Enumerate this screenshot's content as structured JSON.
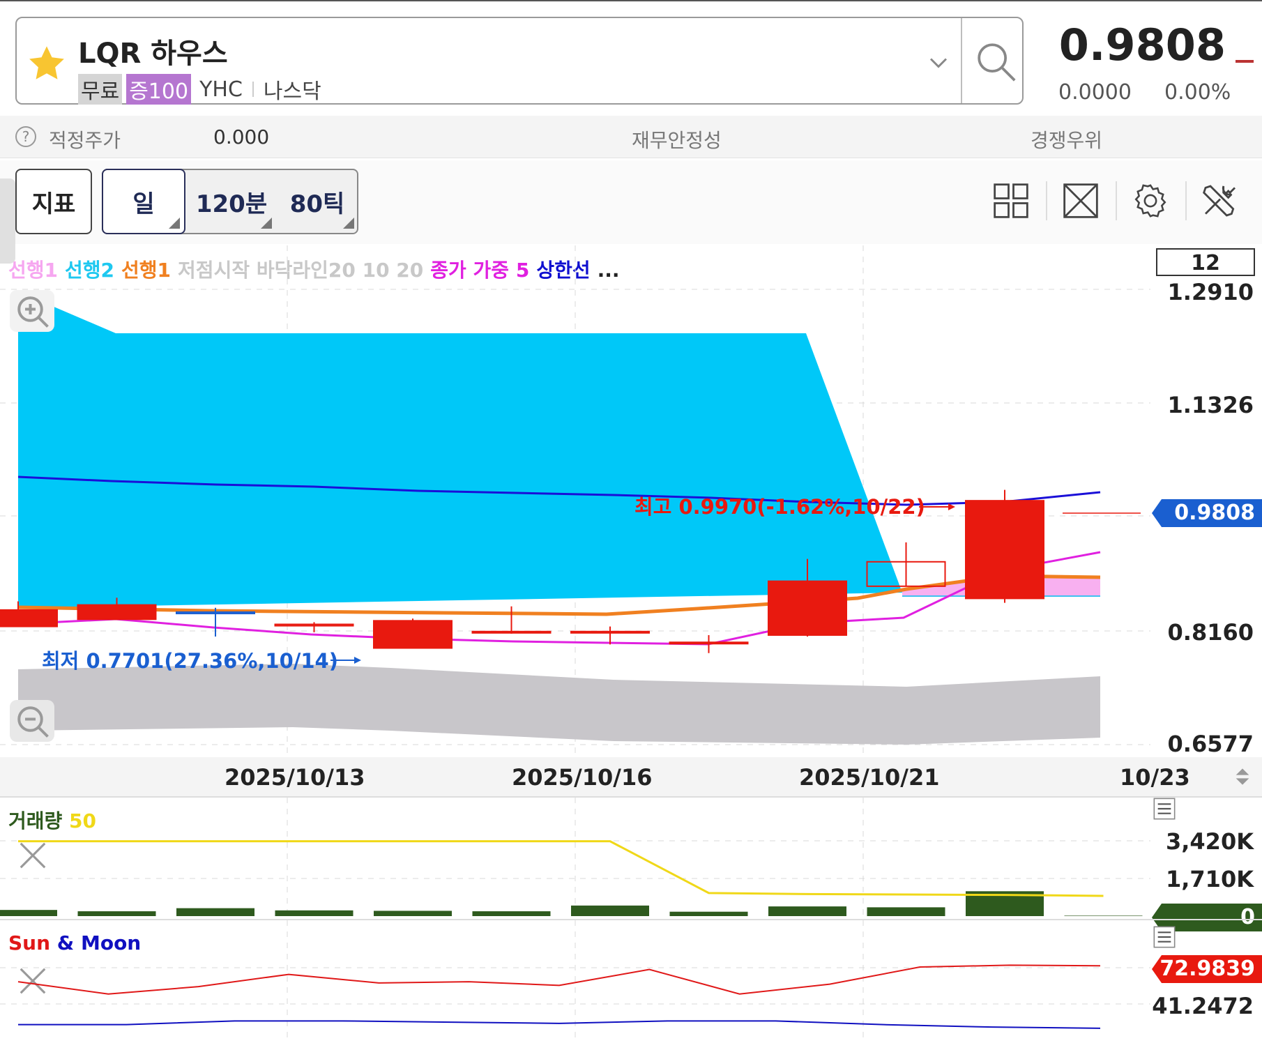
{
  "ticker": {
    "name": "LQR 하우스",
    "badge_free": "무료",
    "badge_margin": "증100",
    "symbol": "YHC",
    "market": "나스닥",
    "price": "0.9808",
    "change": "0.0000",
    "change_pct": "0.00%"
  },
  "valuation": {
    "fair_price_label": "적정주가",
    "fair_price_value": "0.000",
    "financial_label": "재무안정성",
    "competitive_label": "경쟁우위"
  },
  "toolbar": {
    "indicator_label": "지표",
    "period_day": "일",
    "period_min": "120분",
    "period_tick": "80틱"
  },
  "legend": {
    "items": [
      {
        "label": "선행1",
        "color": "#f6a6f0"
      },
      {
        "label": "선행2",
        "color": "#1ec8f0"
      },
      {
        "label": "선행1",
        "color": "#f08020"
      },
      {
        "label": "저점시작 바닥라인20 10 20",
        "color": "#c8c8c8"
      },
      {
        "label": "종가 가중 5",
        "color": "#e020e0"
      },
      {
        "label": "상한선",
        "color": "#1010d0"
      },
      {
        "label": "...",
        "color": "#222222"
      }
    ],
    "count": "12"
  },
  "colors": {
    "up": "#e8190f",
    "cloud_blue": "#00c8f8",
    "cloud_pink": "#f8b0f0",
    "floor_band": "#c8c6ca",
    "upper_line": "#1a0fd8",
    "wma_line": "#e020e0",
    "span1_line": "#f08020",
    "volume_bar": "#2e5a1e",
    "volume_ma": "#f0d818",
    "sun_line": "#e01818",
    "moon_line": "#1010c0",
    "price_tag": "#1a5fd0"
  },
  "chart_data": [
    {
      "type": "candlestick",
      "y_ticks": [
        "1.2910",
        "1.1326",
        "0.9808",
        "0.8160",
        "0.6577"
      ],
      "ylim": [
        0.6577,
        1.291
      ],
      "x_ticks": [
        "2025/10/13",
        "2025/10/16",
        "2025/10/21",
        "10/23"
      ],
      "candles": [
        {
          "open": 0.845,
          "close": 0.822,
          "high": 0.857,
          "low": 0.822
        },
        {
          "open": 0.852,
          "close": 0.832,
          "high": 0.862,
          "low": 0.832
        },
        {
          "open": 0.842,
          "close": 0.84,
          "high": 0.848,
          "low": 0.808
        },
        {
          "open": 0.823,
          "close": 0.825,
          "high": 0.828,
          "low": 0.814
        },
        {
          "open": 0.83,
          "close": 0.792,
          "high": 0.833,
          "low": 0.792
        },
        {
          "open": 0.815,
          "close": 0.815,
          "high": 0.85,
          "low": 0.812
        },
        {
          "open": 0.815,
          "close": 0.815,
          "high": 0.822,
          "low": 0.797
        },
        {
          "open": 0.8,
          "close": 0.8,
          "high": 0.81,
          "low": 0.785
        },
        {
          "open": 0.81,
          "close": 0.885,
          "high": 0.916,
          "low": 0.808
        },
        {
          "open": 0.878,
          "close": 0.912,
          "high": 0.939,
          "low": 0.878
        },
        {
          "open": 0.861,
          "close": 0.997,
          "high": 1.012,
          "low": 0.855
        }
      ],
      "high_annotation": "최고 0.9970(-1.62%,10/22)",
      "low_annotation": "최저 0.7701(27.36%,10/14)",
      "last_price": "0.9808"
    },
    {
      "type": "bar",
      "title": "거래량",
      "ma_label": "50",
      "y_ticks": [
        "3,420K",
        "1,710K",
        "0"
      ],
      "ylim": [
        0,
        3420
      ],
      "values": [
        280,
        220,
        360,
        260,
        240,
        220,
        480,
        200,
        440,
        400,
        1130,
        20
      ],
      "ma_values": [
        3400,
        3400,
        3400,
        3400,
        3400,
        3400,
        3400,
        1050,
        1000,
        980,
        960,
        920
      ]
    },
    {
      "type": "line",
      "title_sun": "Sun",
      "title_amp": "&",
      "title_moon": "Moon",
      "y_ticks": [
        "72.9839",
        "41.2472"
      ],
      "sun_values": [
        60,
        50,
        56,
        66,
        59,
        60,
        57,
        70,
        50,
        58,
        72,
        73.5,
        73
      ],
      "moon_values": [
        25,
        25,
        28,
        28,
        27,
        26,
        28,
        28,
        25,
        23,
        22
      ]
    }
  ]
}
